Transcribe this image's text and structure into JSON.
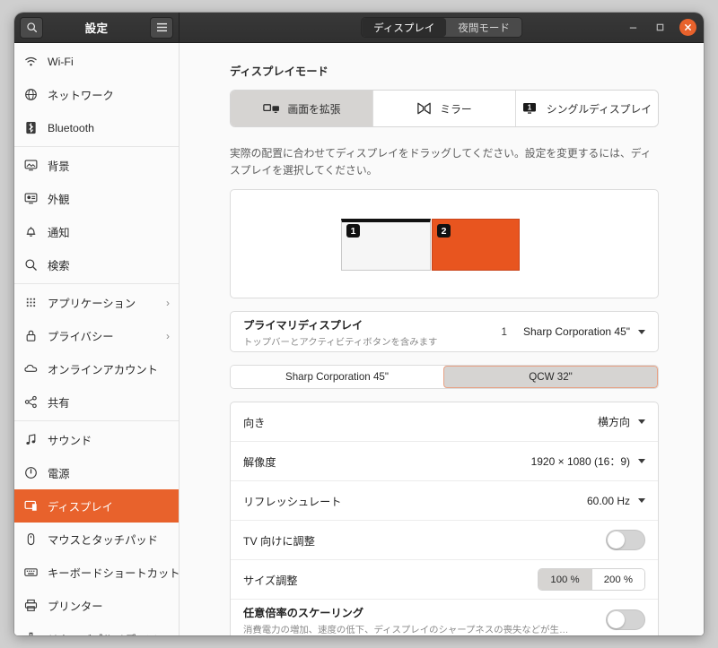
{
  "window": {
    "title": "設定",
    "search_icon": "search-icon",
    "menu_icon": "hamburger-menu-icon",
    "minimize_label": "−",
    "maximize_label": "□",
    "close_label": "✕"
  },
  "tabs": [
    {
      "label": "ディスプレイ",
      "active": true
    },
    {
      "label": "夜間モード",
      "active": false
    }
  ],
  "sidebar": {
    "items": [
      {
        "label": "Wi-Fi",
        "icon": "wifi-icon",
        "active": false,
        "chevron": false
      },
      {
        "label": "ネットワーク",
        "icon": "globe-icon",
        "active": false,
        "chevron": false
      },
      {
        "label": "Bluetooth",
        "icon": "bluetooth-icon",
        "active": false,
        "chevron": false
      },
      {
        "label": "背景",
        "icon": "wallpaper-icon",
        "active": false,
        "chevron": false,
        "separator_before": true
      },
      {
        "label": "外観",
        "icon": "appearance-icon",
        "active": false,
        "chevron": false
      },
      {
        "label": "通知",
        "icon": "bell-icon",
        "active": false,
        "chevron": false
      },
      {
        "label": "検索",
        "icon": "search-icon",
        "active": false,
        "chevron": false
      },
      {
        "label": "アプリケーション",
        "icon": "grid-apps-icon",
        "active": false,
        "chevron": true,
        "separator_before": true
      },
      {
        "label": "プライバシー",
        "icon": "lock-icon",
        "active": false,
        "chevron": true
      },
      {
        "label": "オンラインアカウント",
        "icon": "cloud-icon",
        "active": false,
        "chevron": false
      },
      {
        "label": "共有",
        "icon": "share-icon",
        "active": false,
        "chevron": false
      },
      {
        "label": "サウンド",
        "icon": "music-note-icon",
        "active": false,
        "chevron": false,
        "separator_before": true
      },
      {
        "label": "電源",
        "icon": "power-icon",
        "active": false,
        "chevron": false
      },
      {
        "label": "ディスプレイ",
        "icon": "display-icon",
        "active": true,
        "chevron": false
      },
      {
        "label": "マウスとタッチパッド",
        "icon": "mouse-icon",
        "active": false,
        "chevron": false
      },
      {
        "label": "キーボードショートカット",
        "icon": "keyboard-icon",
        "active": false,
        "chevron": false
      },
      {
        "label": "プリンター",
        "icon": "printer-icon",
        "active": false,
        "chevron": false
      },
      {
        "label": "リムーバブルメディア",
        "icon": "usb-icon",
        "active": false,
        "chevron": false
      }
    ]
  },
  "main": {
    "display_mode_title": "ディスプレイモード",
    "modes": [
      {
        "label": "画面を拡張",
        "icon": "join-displays-icon",
        "active": true
      },
      {
        "label": "ミラー",
        "icon": "mirror-icon",
        "active": false
      },
      {
        "label": "シングルディスプレイ",
        "icon": "single-display-icon",
        "active": false
      }
    ],
    "hint": "実際の配置に合わせてディスプレイをドラッグしてください。設定を変更するには、ディスプレイを選択してください。",
    "monitors": [
      {
        "number": "1",
        "selected": false
      },
      {
        "number": "2",
        "selected": true
      }
    ],
    "primary": {
      "title": "プライマリディスプレイ",
      "subtitle": "トップバーとアクティビティボタンを含みます",
      "value_number": "1",
      "value": "Sharp Corporation 45\""
    },
    "monitor_tabs": [
      {
        "label": "Sharp Corporation 45\"",
        "active": false
      },
      {
        "label": "QCW 32\"",
        "active": true
      }
    ],
    "settings": [
      {
        "name": "orientation",
        "title": "向き",
        "value": "横方向",
        "control": "dropdown"
      },
      {
        "name": "resolution",
        "title": "解像度",
        "value": "1920 × 1080 (16：9)",
        "control": "dropdown"
      },
      {
        "name": "refresh-rate",
        "title": "リフレッシュレート",
        "value": "60.00 Hz",
        "control": "dropdown"
      },
      {
        "name": "adjust-for-tv",
        "title": "TV 向けに調整",
        "control": "toggle",
        "on": false
      },
      {
        "name": "scale",
        "title": "サイズ調整",
        "control": "segmented",
        "options": [
          "100 %",
          "200 %"
        ],
        "selected": "100 %"
      },
      {
        "name": "fractional-scaling",
        "title": "任意倍率のスケーリング",
        "subtitle": "消費電力の増加、速度の低下、ディスプレイのシャープネスの喪失などが生じる可能性があ…",
        "control": "toggle",
        "on": false
      }
    ]
  },
  "colors": {
    "accent": "#e8622c",
    "monitor_selected": "#e8551f",
    "headerbar": "#303030",
    "segment_active": "#d6d4d2"
  }
}
